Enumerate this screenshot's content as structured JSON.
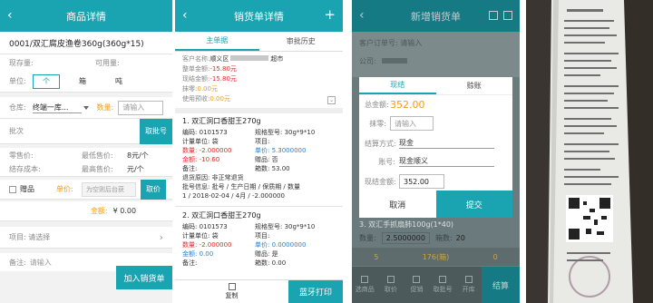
{
  "panel1": {
    "title": "商品详情",
    "back": "‹",
    "product": "0001/双汇腐皮渔卷360g(360g*15)",
    "stock_label": "现存量:",
    "avail_label": "可用量:",
    "unit_label": "单位:",
    "units": [
      "个",
      "箱",
      "吨"
    ],
    "warehouse_label": "仓库:",
    "warehouse_value": "终端一库...",
    "qty_label": "数量:",
    "qty_placeholder": "请输入",
    "batch_label": "批次",
    "batch_button": "取批号",
    "retail_label": "零售价:",
    "min_price_label": "最低售价:",
    "min_price_value": "8元/个",
    "cost_label": "结存成本:",
    "max_price_label": "最高售价:",
    "max_price_value": "元/个",
    "gift_label": "赠品",
    "unit_price_label": "单价:",
    "unit_price_placeholder": "为空则后台获",
    "price_button": "取价",
    "amount_label": "金额:",
    "amount_value": "¥ 0.00",
    "project_label": "项目: 请选择",
    "remark_label": "备注:",
    "remark_placeholder": "请输入",
    "add_button": "加入销货单"
  },
  "panel2": {
    "title": "销货单详情",
    "back": "‹",
    "plus": "+",
    "tabs": [
      "主单据",
      "审批历史"
    ],
    "customer_label": "客户名称:",
    "customer_value": "顺义区",
    "customer_suffix": "超市",
    "whole_amount_label": "整单金额:",
    "whole_amount": "-15.80元",
    "discount_amount_label": "现结金额:",
    "discount_amount": "-15.80元",
    "discount_label": "抹零:",
    "discount_value": "0.00元",
    "prepaid_label": "使用预收:",
    "prepaid_value": "0.00元",
    "items": [
      {
        "title": "1. 双汇洞口香甜王270g",
        "code": "编码: 0101573",
        "spec": "规格型号: 30g*9*10",
        "unit": "计量单位: 袋",
        "project": "项目:",
        "qty": "数量: -2.000000",
        "price": "单价: 5.3000000",
        "amount": "金额: -10.60",
        "gift": "赠品: 否",
        "remark": "备注:",
        "pieces": "箱数: 53.00",
        "reason": "退货原因: 非正常退货",
        "batch": "批号信息: 批号 / 生产日期 / 保质期 / 数量",
        "batch_detail": "1 / 2018-02-04 / 4月 / -2.000000"
      },
      {
        "title": "2. 双汇洞口香甜王270g",
        "code": "编码: 0101573",
        "spec": "规格型号: 30g*9*10",
        "unit": "计量单位: 袋",
        "project": "项目:",
        "qty": "数量: -2.000000",
        "price": "单价: 0.0000000",
        "amount": "金额: 0.00",
        "gift": "赠品: 是",
        "remark": "备注:",
        "pieces": "箱数: 0.00"
      }
    ],
    "copy_label": "复制",
    "print_button": "蓝牙打印"
  },
  "panel3": {
    "title": "新增销货单",
    "back": "‹",
    "bg_order_label": "客户订单号: 请输入",
    "bg_company_label": "公司:",
    "dialog_tabs": [
      "现结",
      "赊账"
    ],
    "total_label": "总金额:",
    "total_value": "352.00",
    "discount_label": "抹零:",
    "discount_placeholder": "请输入",
    "method_label": "结算方式:",
    "method_value": "现金",
    "account_label": "账号:",
    "account_value": "现金顺义",
    "cash_label": "现结金额:",
    "cash_value": "352.00",
    "cancel_button": "取消",
    "submit_button": "提交",
    "bg_item": "3. 双汇手抓扇肺100g(1*40)",
    "bg_qty_label": "数量:",
    "bg_qty_value": "2.5000000",
    "bg_box_label": "箱数:",
    "bg_box_value": "20",
    "bottom_nav": [
      "选商品",
      "取价",
      "促销",
      "取批号",
      "开库"
    ],
    "bottom_counts": [
      "5",
      "176(箱)",
      "0"
    ],
    "settle_button": "结算"
  },
  "colors": {
    "teal": "#1aa3b0",
    "red": "#e8292c",
    "orange": "#f39c12",
    "blue": "#2a7fd4"
  }
}
